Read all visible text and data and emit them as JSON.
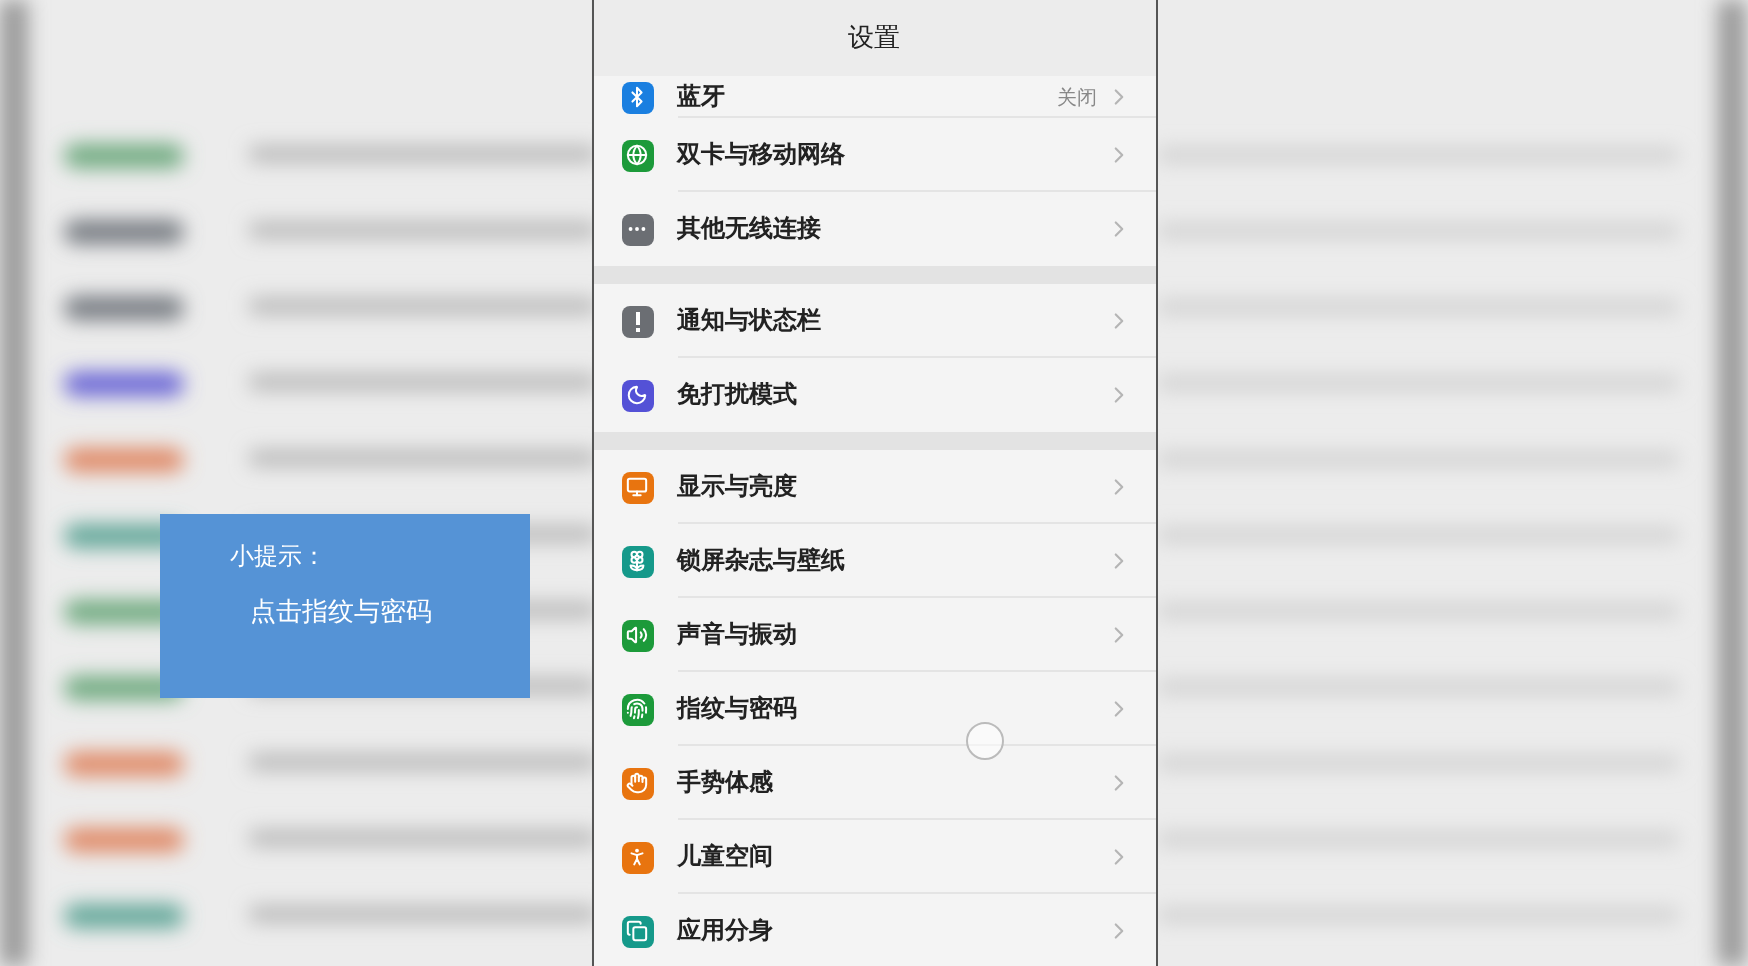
{
  "title": "设置",
  "sections": [
    [
      {
        "label": "蓝牙",
        "value": "关闭",
        "kind": "bluetooth",
        "color": "#1a7fe0"
      },
      {
        "label": "双卡与移动网络",
        "kind": "globe",
        "color": "#1c9a3a"
      },
      {
        "label": "其他无线连接",
        "kind": "more",
        "color": "#6b6e73"
      }
    ],
    [
      {
        "label": "通知与状态栏",
        "kind": "alert",
        "color": "#6b6e73"
      },
      {
        "label": "免打扰模式",
        "kind": "moon",
        "color": "#5451d6"
      }
    ],
    [
      {
        "label": "显示与亮度",
        "kind": "monitor",
        "color": "#e8740f"
      },
      {
        "label": "锁屏杂志与壁纸",
        "kind": "flower",
        "color": "#15998a"
      },
      {
        "label": "声音与振动",
        "kind": "sound",
        "color": "#1c9a3a"
      },
      {
        "label": "指纹与密码",
        "kind": "fingerprint",
        "color": "#1c9a3a"
      },
      {
        "label": "手势体感",
        "kind": "hand",
        "color": "#e8740f"
      },
      {
        "label": "儿童空间",
        "kind": "child",
        "color": "#e8740f"
      },
      {
        "label": "应用分身",
        "kind": "copy",
        "color": "#15998a"
      }
    ]
  ],
  "tip": {
    "title": "小提示：",
    "text": "点击指纹与密码"
  }
}
